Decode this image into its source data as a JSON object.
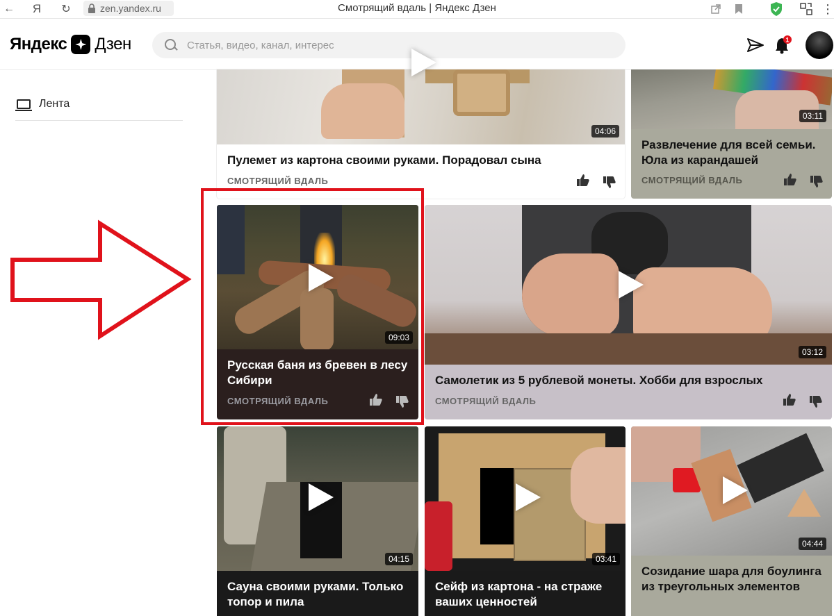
{
  "browser": {
    "back_glyph": "←",
    "yandex_glyph": "Я",
    "reload_glyph": "↻",
    "url": "zen.yandex.ru",
    "page_title": "Смотрящий вдаль | Яндекс Дзен"
  },
  "header": {
    "logo_yandex": "Яндекс",
    "logo_zen": "Дзен",
    "search_placeholder": "Статья, видео, канал, интерес",
    "notifications_count": "1"
  },
  "sidebar": {
    "items": [
      {
        "label": "Лента",
        "icon": "monitor-icon"
      }
    ]
  },
  "cards": [
    {
      "title": "Пулемет из картона своими руками. Порадовал сына",
      "source": "СМОТРЯЩИЙ ВДАЛЬ",
      "duration": "04:06"
    },
    {
      "title": "Развлечение для всей семьи. Юла из карандашей",
      "source": "СМОТРЯЩИЙ ВДАЛЬ",
      "duration": "03:11"
    },
    {
      "title": "Русская баня из бревен в лесу Сибири",
      "source": "СМОТРЯЩИЙ ВДАЛЬ",
      "duration": "09:03"
    },
    {
      "title": "Самолетик из 5 рублевой монеты. Хобби для взрослых",
      "source": "СМОТРЯЩИЙ ВДАЛЬ",
      "duration": "03:12"
    },
    {
      "title": "Сауна своими руками. Только топор и пила",
      "source": "",
      "duration": "04:15"
    },
    {
      "title": "Сейф из картона - на страже ваших ценностей",
      "source": "",
      "duration": "03:41"
    },
    {
      "title": "Созидание шара для боулинга из треугольных элементов",
      "source": "",
      "duration": "04:44"
    }
  ],
  "colors": {
    "highlight": "#e0121b",
    "notification_badge": "#e0121b",
    "card_dark_bg": "#2b1f1e",
    "card_olive_bg": "#a9a99c",
    "card_lilac_bg": "#c7c0c8",
    "card_light_bg": "#ffffff"
  }
}
